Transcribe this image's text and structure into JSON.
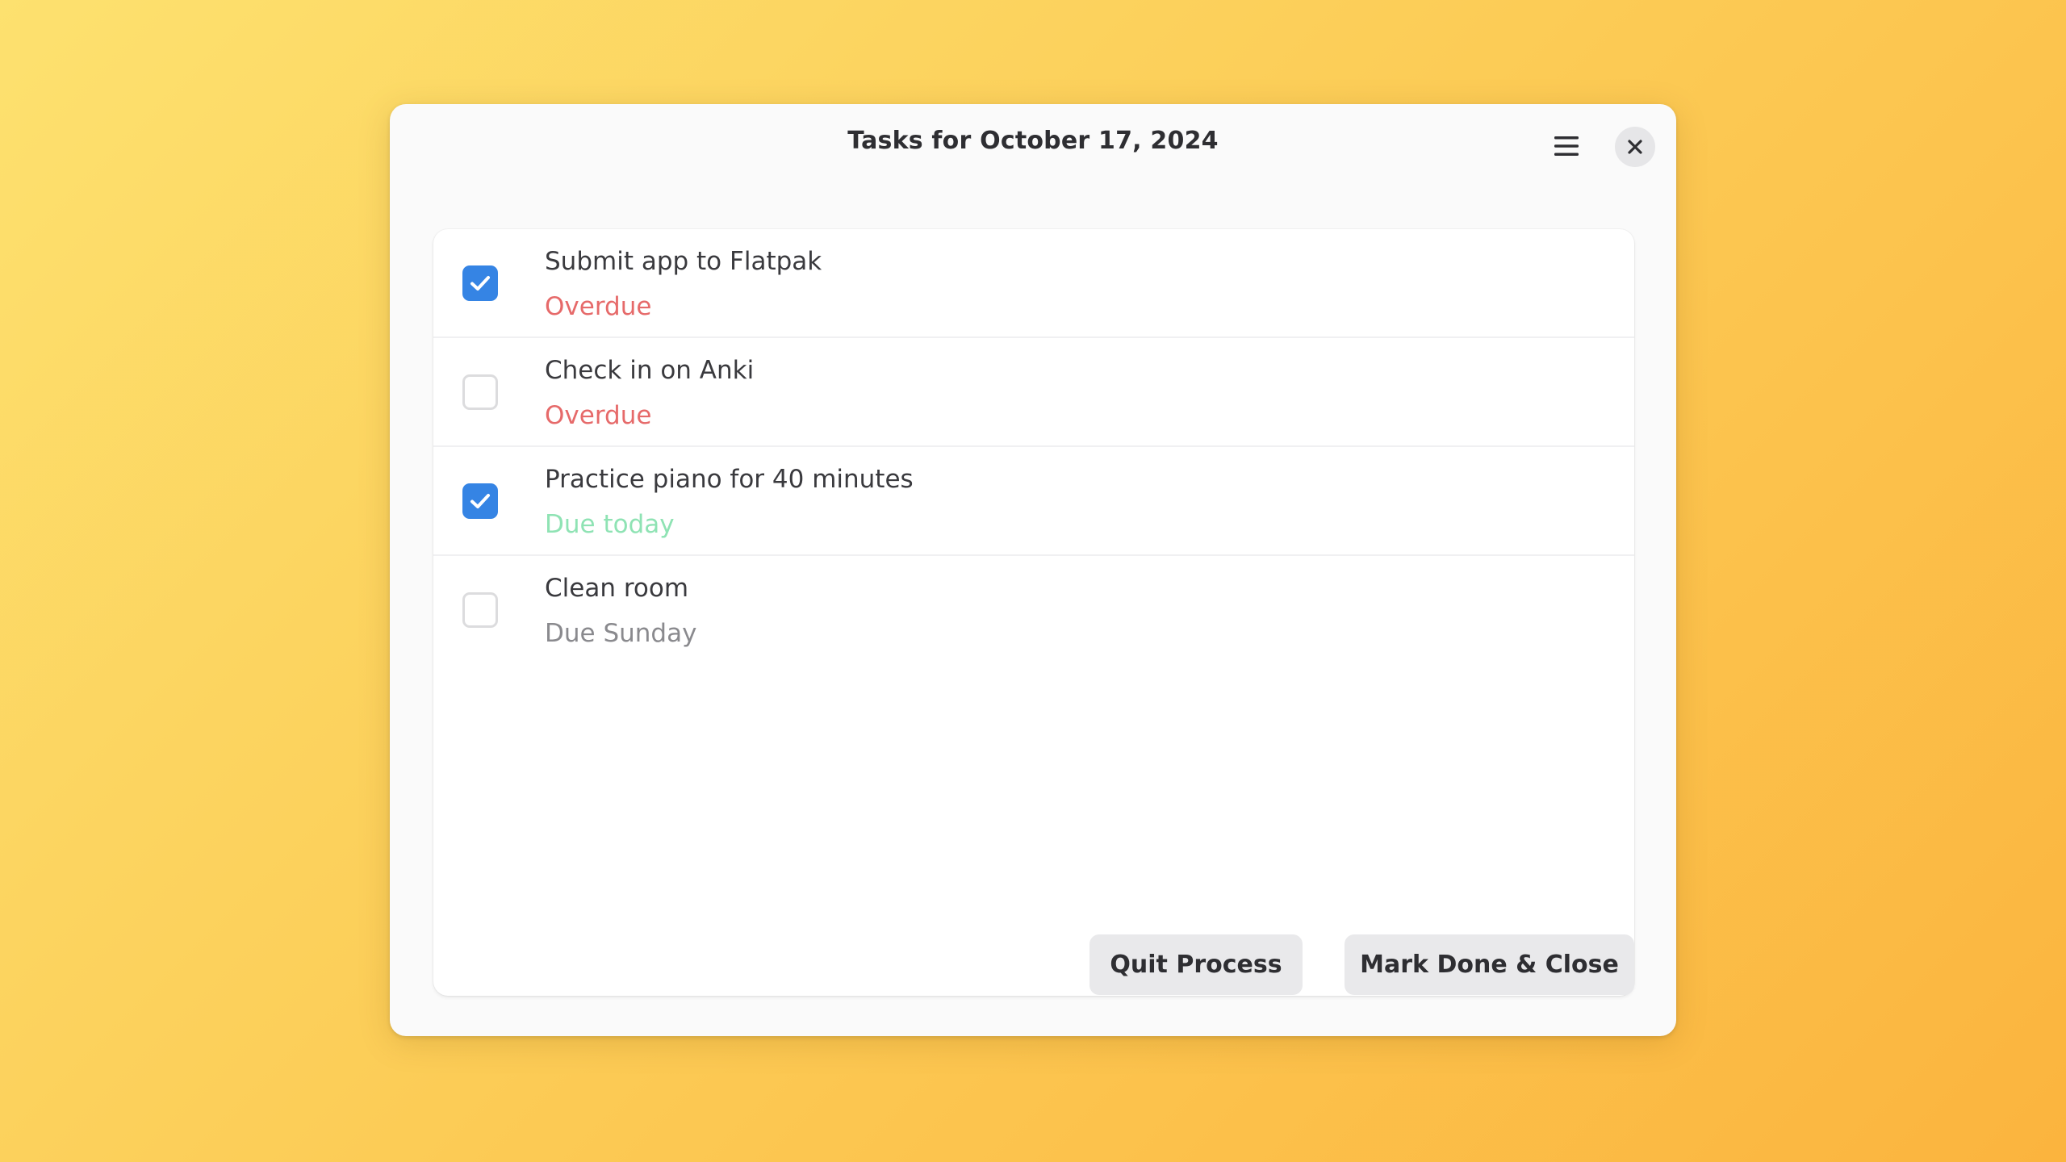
{
  "window": {
    "title": "Tasks for October 17, 2024"
  },
  "colors": {
    "accent": "#3584e4",
    "overdue": "#e66a6a",
    "due_today": "#8fe3b4",
    "due_later": "#8a8a8e"
  },
  "icons": {
    "menu": "hamburger-menu-icon",
    "close": "close-icon",
    "check": "checkmark-icon"
  },
  "tasks": [
    {
      "title": "Submit app to Flatpak",
      "due": "Overdue",
      "status": "overdue",
      "checked": true
    },
    {
      "title": "Check in on Anki",
      "due": "Overdue",
      "status": "overdue",
      "checked": false
    },
    {
      "title": "Practice piano for 40 minutes",
      "due": "Due today",
      "status": "today",
      "checked": true
    },
    {
      "title": "Clean room",
      "due": "Due Sunday",
      "status": "later",
      "checked": false
    }
  ],
  "footer": {
    "quit_label": "Quit Process",
    "done_label": "Mark Done & Close"
  }
}
